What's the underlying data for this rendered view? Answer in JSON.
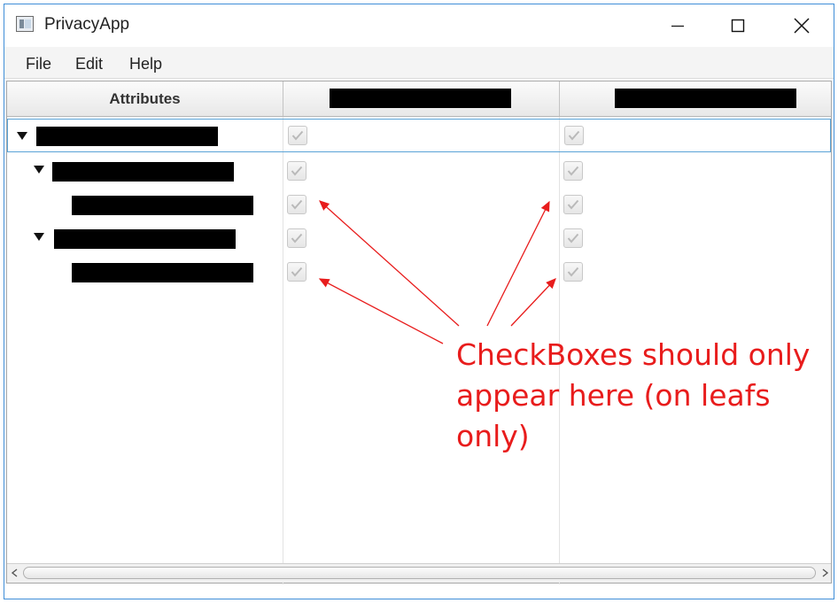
{
  "window": {
    "title": "PrivacyApp"
  },
  "menu": {
    "items": [
      "File",
      "Edit",
      "Help"
    ]
  },
  "table": {
    "columns": [
      {
        "label": "Attributes",
        "redacted": false
      },
      {
        "label": "",
        "redacted": true
      },
      {
        "label": "",
        "redacted": true
      }
    ],
    "rows": [
      {
        "level": 0,
        "expanded": true,
        "redacted_label": true,
        "col1_checked": true,
        "col2_checked": true,
        "selected": true
      },
      {
        "level": 1,
        "expanded": true,
        "redacted_label": true,
        "col1_checked": true,
        "col2_checked": true,
        "selected": false
      },
      {
        "level": 2,
        "expanded": null,
        "redacted_label": true,
        "col1_checked": true,
        "col2_checked": true,
        "selected": false
      },
      {
        "level": 1,
        "expanded": true,
        "redacted_label": true,
        "col1_checked": true,
        "col2_checked": true,
        "selected": false
      },
      {
        "level": 2,
        "expanded": null,
        "redacted_label": true,
        "col1_checked": true,
        "col2_checked": true,
        "selected": false
      }
    ]
  },
  "annotation": {
    "text": "CheckBoxes should only appear here (on leafs only)",
    "color": "#e81c1c"
  },
  "colors": {
    "window_border": "#3f8ed8",
    "selection_border": "#5aa3d6",
    "menu_bg": "#f4f4f4"
  }
}
